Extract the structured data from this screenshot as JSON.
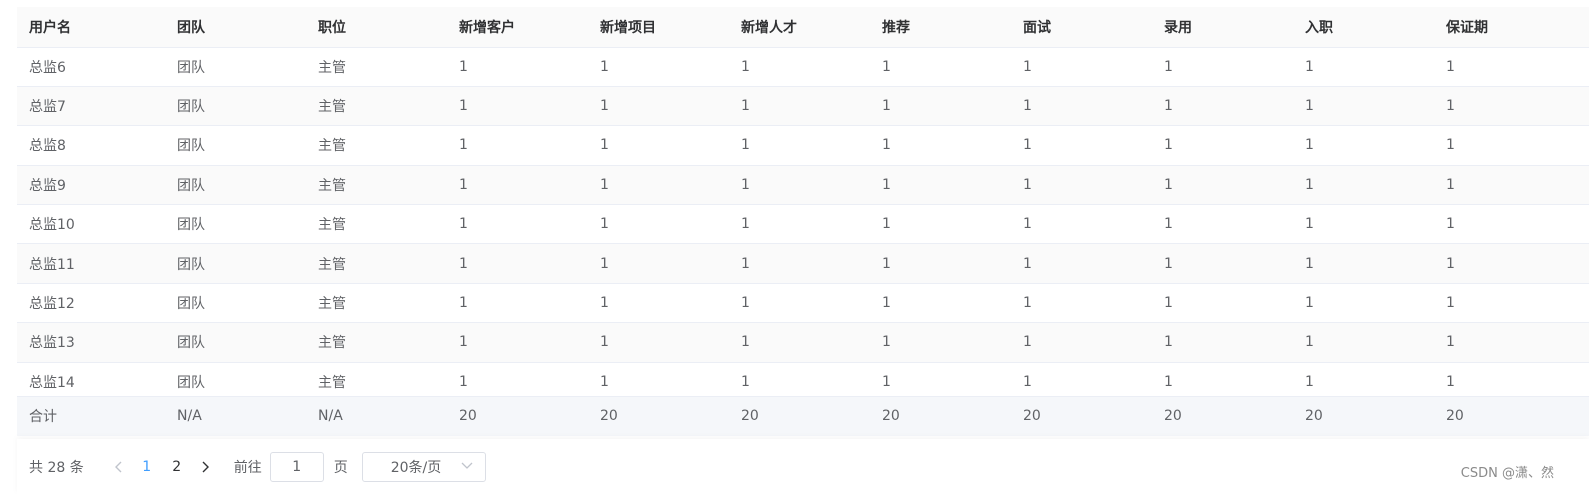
{
  "table": {
    "columns": [
      "用户名",
      "团队",
      "职位",
      "新增客户",
      "新增项目",
      "新增人才",
      "推荐",
      "面试",
      "录用",
      "入职",
      "保证期"
    ],
    "rows": [
      [
        "总监6",
        "团队",
        "主管",
        "1",
        "1",
        "1",
        "1",
        "1",
        "1",
        "1",
        "1"
      ],
      [
        "总监7",
        "团队",
        "主管",
        "1",
        "1",
        "1",
        "1",
        "1",
        "1",
        "1",
        "1"
      ],
      [
        "总监8",
        "团队",
        "主管",
        "1",
        "1",
        "1",
        "1",
        "1",
        "1",
        "1",
        "1"
      ],
      [
        "总监9",
        "团队",
        "主管",
        "1",
        "1",
        "1",
        "1",
        "1",
        "1",
        "1",
        "1"
      ],
      [
        "总监10",
        "团队",
        "主管",
        "1",
        "1",
        "1",
        "1",
        "1",
        "1",
        "1",
        "1"
      ],
      [
        "总监11",
        "团队",
        "主管",
        "1",
        "1",
        "1",
        "1",
        "1",
        "1",
        "1",
        "1"
      ],
      [
        "总监12",
        "团队",
        "主管",
        "1",
        "1",
        "1",
        "1",
        "1",
        "1",
        "1",
        "1"
      ],
      [
        "总监13",
        "团队",
        "主管",
        "1",
        "1",
        "1",
        "1",
        "1",
        "1",
        "1",
        "1"
      ],
      [
        "总监14",
        "团队",
        "主管",
        "1",
        "1",
        "1",
        "1",
        "1",
        "1",
        "1",
        "1"
      ]
    ],
    "summary": [
      "合计",
      "N/A",
      "N/A",
      "20",
      "20",
      "20",
      "20",
      "20",
      "20",
      "20",
      "20"
    ]
  },
  "pagination": {
    "total_text": "共 28 条",
    "pages": [
      "1",
      "2"
    ],
    "active_page": "1",
    "prev_icon": "chevron-left-icon",
    "next_icon": "chevron-right-icon",
    "goto_label": "前往",
    "goto_value": "1",
    "goto_suffix": "页",
    "page_size": "20条/页"
  },
  "watermark": "CSDN @潇、然",
  "colors": {
    "active_page": "#409eff",
    "header_bg": "#fafafa",
    "summary_bg": "#f5f7fa",
    "border": "#ebeef5"
  }
}
